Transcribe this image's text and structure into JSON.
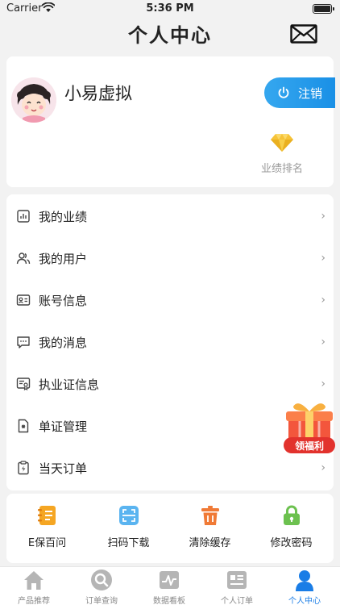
{
  "status_bar": {
    "carrier": "Carrier",
    "time": "5:36 PM"
  },
  "nav": {
    "title": "个人中心"
  },
  "profile": {
    "username": "小易虚拟",
    "logout_label": "注销",
    "rank_label": "业绩排名"
  },
  "menu": [
    {
      "label": "我的业绩",
      "icon": "chart-icon"
    },
    {
      "label": "我的用户",
      "icon": "users-icon"
    },
    {
      "label": "账号信息",
      "icon": "id-card-icon"
    },
    {
      "label": "我的消息",
      "icon": "message-icon"
    },
    {
      "label": "执业证信息",
      "icon": "certificate-icon"
    },
    {
      "label": "单证管理",
      "icon": "document-icon"
    },
    {
      "label": "当天订单",
      "icon": "clipboard-icon"
    }
  ],
  "promo": {
    "label": "领福利"
  },
  "tools": [
    {
      "label": "E保百问",
      "icon": "notebook-icon",
      "color": "#f5a623"
    },
    {
      "label": "扫码下载",
      "icon": "scan-icon",
      "color": "#5ab4f0"
    },
    {
      "label": "清除缓存",
      "icon": "trash-icon",
      "color": "#f07a36"
    },
    {
      "label": "修改密码",
      "icon": "lock-icon",
      "color": "#6cc14f"
    }
  ],
  "tabs": [
    {
      "label": "产品推荐",
      "icon": "home-icon"
    },
    {
      "label": "订单查询",
      "icon": "search-icon"
    },
    {
      "label": "数据看板",
      "icon": "dashboard-icon"
    },
    {
      "label": "个人订单",
      "icon": "orders-icon"
    },
    {
      "label": "个人中心",
      "icon": "person-icon",
      "active": true
    }
  ],
  "colors": {
    "accent": "#1a90e6",
    "tab_active": "#1a7de6",
    "background": "#f2f2f2"
  }
}
